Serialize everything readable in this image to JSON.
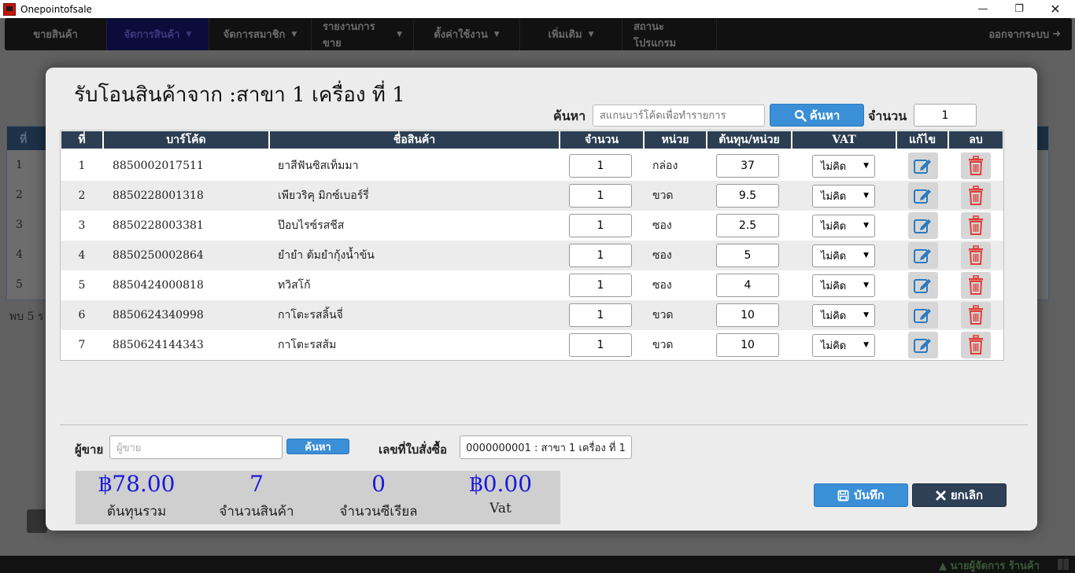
{
  "window": {
    "title": "Onepointofsale"
  },
  "nav": {
    "items": [
      "ขายสินค้า",
      "จัดการสินค้า",
      "จัดการสมาชิก",
      "รายงานการขาย",
      "ตั้งค่าใช้งาน",
      "เพิ่มเติม",
      "สถานะโปรแกรม"
    ],
    "logout": "ออกจากระบบ"
  },
  "background": {
    "head": "ที่",
    "rows": [
      "1",
      "2",
      "3",
      "4",
      "5"
    ],
    "found": "พบ 5 ร"
  },
  "status": {
    "user": "นายผู้จัดการ ร้านค้า"
  },
  "modal": {
    "title": "รับโอนสินค้าจาก :สาขา 1 เครื่อง ที่ 1",
    "search_label": "ค้นหา",
    "search_placeholder": "สแกนบาร์โค้ดเพื่อทำรายการ",
    "search_button": "ค้นหา",
    "qty_label": "จำนวน",
    "qty_value": "1"
  },
  "table": {
    "headers": [
      "ที่",
      "บาร์โค้ด",
      "ชื่อสินค้า",
      "จำนวน",
      "หน่วย",
      "ต้นทุน/หน่วย",
      "VAT",
      "แก้ไข",
      "ลบ"
    ],
    "rows": [
      {
        "no": "1",
        "barcode": "8850002017511",
        "name": "ยาสีฟันซิสเท็มมา",
        "qty": "1",
        "unit": "กล่อง",
        "cost": "37",
        "vat": "ไม่คิด"
      },
      {
        "no": "2",
        "barcode": "8850228001318",
        "name": "เพียวริคุ มิกซ์เบอร์รี่",
        "qty": "1",
        "unit": "ขวด",
        "cost": "9.5",
        "vat": "ไม่คิด"
      },
      {
        "no": "3",
        "barcode": "8850228003381",
        "name": "ป๊อบไรซ์รสชีส",
        "qty": "1",
        "unit": "ซอง",
        "cost": "2.5",
        "vat": "ไม่คิด"
      },
      {
        "no": "4",
        "barcode": "8850250002864",
        "name": "ยำยำ ต้มยำกุ้งน้ำข้น",
        "qty": "1",
        "unit": "ซอง",
        "cost": "5",
        "vat": "ไม่คิด"
      },
      {
        "no": "5",
        "barcode": "8850424000818",
        "name": "ทวิสโก้",
        "qty": "1",
        "unit": "ซอง",
        "cost": "4",
        "vat": "ไม่คิด"
      },
      {
        "no": "6",
        "barcode": "8850624340998",
        "name": "กาโตะรสลิ้นจี่",
        "qty": "1",
        "unit": "ขวด",
        "cost": "10",
        "vat": "ไม่คิด"
      },
      {
        "no": "7",
        "barcode": "8850624144343",
        "name": "กาโตะรสส้ม",
        "qty": "1",
        "unit": "ขวด",
        "cost": "10",
        "vat": "ไม่คิด"
      }
    ]
  },
  "footer": {
    "seller_label": "ผู้ขาย",
    "seller_placeholder": "ผู้ขาย",
    "seller_button": "ค้นหา",
    "po_label": "เลขที่ใบสั่งซื้อ",
    "po_value": "0000000001 : สาขา 1 เครื่อง ที่ 1"
  },
  "summary": {
    "total_cost": "฿78.00",
    "total_cost_label": "ต้นทุนรวม",
    "item_count": "7",
    "item_count_label": "จำนวนสินค้า",
    "serial_count": "0",
    "serial_count_label": "จำนวนซีเรียล",
    "vat": "฿0.00",
    "vat_label": "Vat"
  },
  "actions": {
    "save": "บันทึก",
    "cancel": "ยกเลิก"
  },
  "colors": {
    "primary": "#3a8fd6",
    "header": "#2c3e52",
    "summary_value": "#1a1ad8",
    "delete": "#e0403a"
  }
}
